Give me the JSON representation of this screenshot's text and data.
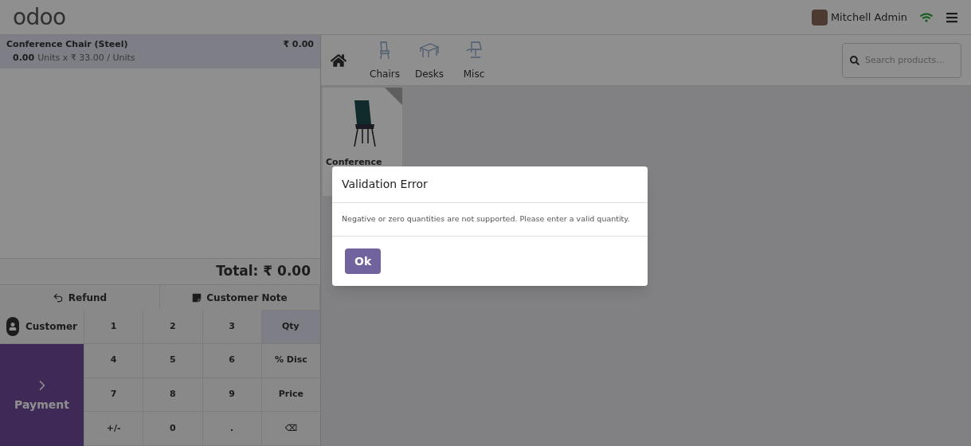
{
  "header": {
    "logo": "odoo",
    "user": "Mitchell Admin"
  },
  "order_lines": [
    {
      "name": "Conference Chair (Steel)",
      "price": "₹ 0.00",
      "qty": "0.00",
      "detail": "Units x ₹ 33.00 / Units",
      "selected": true
    }
  ],
  "total": "Total: ₹ 0.00",
  "actions": [
    {
      "kind": "refund",
      "label": "Refund"
    },
    {
      "kind": "note",
      "label": "Customer Note"
    }
  ],
  "customer": "Customer",
  "payment": {
    "label": "Payment"
  },
  "numpad": [
    {
      "label": "1",
      "selected": false
    },
    {
      "label": "2",
      "selected": false
    },
    {
      "label": "3",
      "selected": false
    },
    {
      "label": "Qty",
      "selected": true
    },
    {
      "label": "4",
      "selected": false
    },
    {
      "label": "5",
      "selected": false
    },
    {
      "label": "6",
      "selected": false
    },
    {
      "label": "% Disc",
      "selected": false
    },
    {
      "label": "7",
      "selected": false
    },
    {
      "label": "8",
      "selected": false
    },
    {
      "label": "9",
      "selected": false
    },
    {
      "label": "Price",
      "selected": false
    },
    {
      "label": "+/-",
      "selected": false
    },
    {
      "label": "0",
      "selected": false
    },
    {
      "label": ".",
      "selected": false
    },
    {
      "label": "⌫",
      "selected": false
    }
  ],
  "categories": [
    {
      "kind": "chair",
      "label": "Chairs"
    },
    {
      "kind": "desk",
      "label": "Desks"
    },
    {
      "kind": "misc",
      "label": "Misc"
    }
  ],
  "search": {
    "placeholder": "Search products..."
  },
  "products": [
    {
      "name": "Conference"
    }
  ],
  "dialog": {
    "title": "Validation Error",
    "message": "Negative or zero quantities are not supported. Please enter a valid quantity.",
    "button": "Ok"
  }
}
